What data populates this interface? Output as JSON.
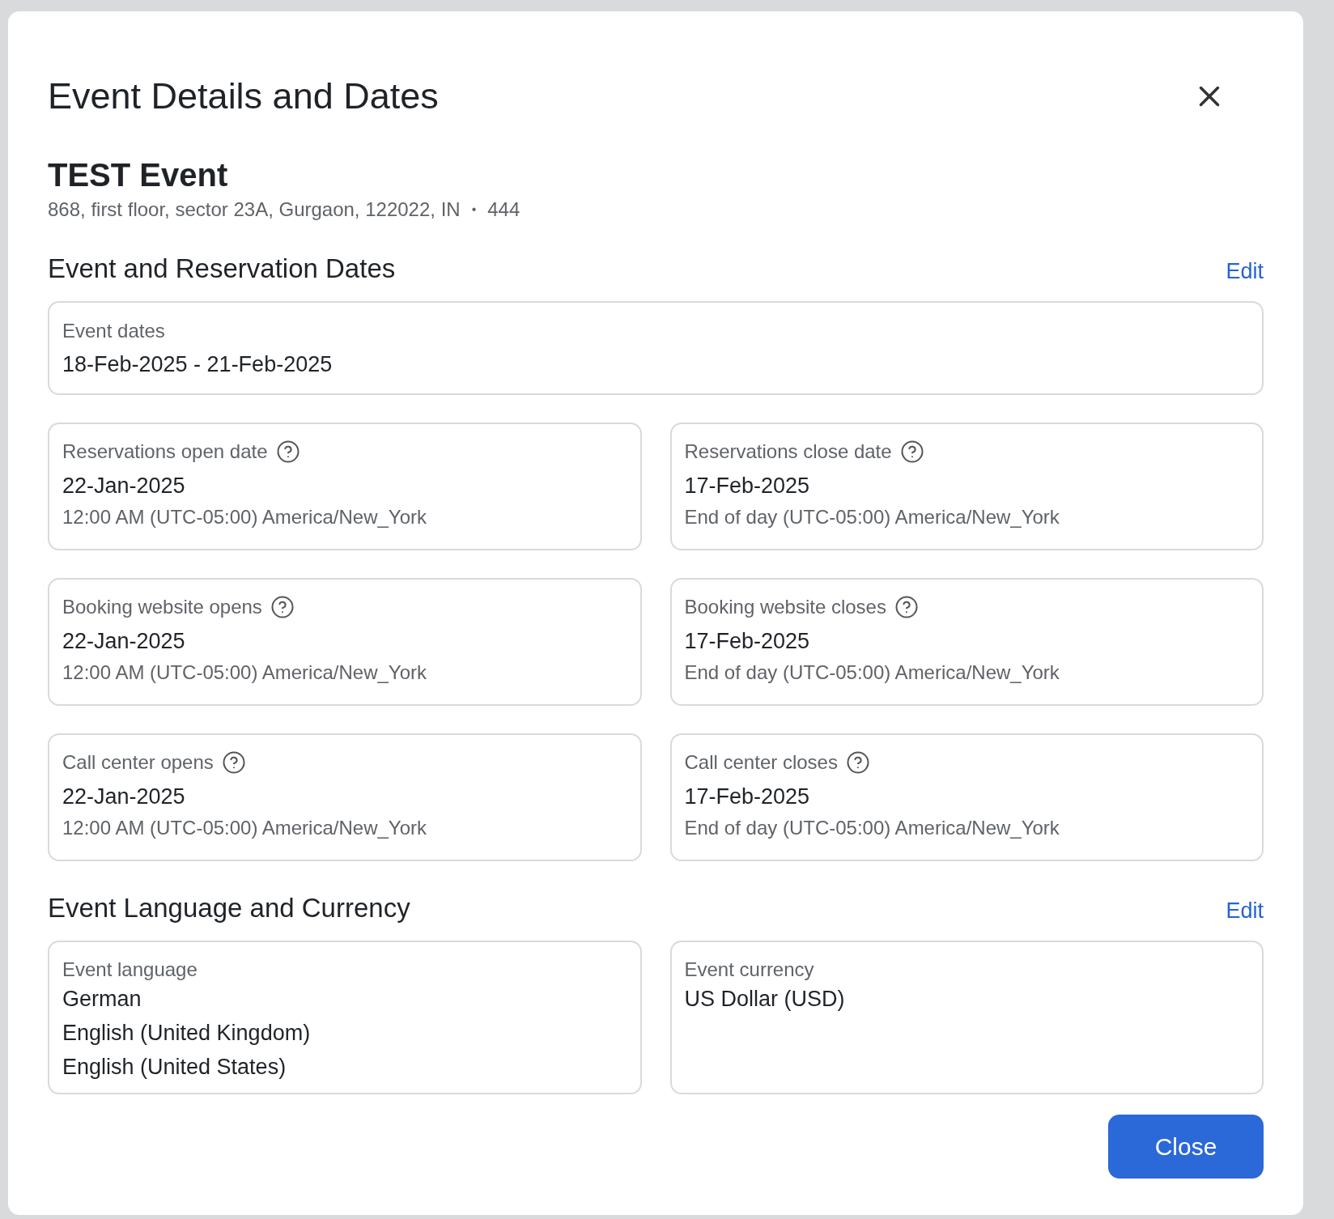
{
  "dialog": {
    "title": "Event Details and Dates"
  },
  "event": {
    "name": "TEST Event",
    "address": "868, first floor, sector 23A, Gurgaon, 122022, IN",
    "separator": "•",
    "code": "444"
  },
  "dates_section": {
    "heading": "Event and Reservation Dates",
    "edit": "Edit",
    "event_dates": {
      "label": "Event dates",
      "value": "18-Feb-2025 - 21-Feb-2025"
    },
    "items": [
      {
        "label": "Reservations open date",
        "date": "22-Jan-2025",
        "detail": "12:00 AM (UTC-05:00) America/New_York"
      },
      {
        "label": "Reservations close date",
        "date": "17-Feb-2025",
        "detail": "End of day (UTC-05:00) America/New_York"
      },
      {
        "label": "Booking website opens",
        "date": "22-Jan-2025",
        "detail": "12:00 AM (UTC-05:00) America/New_York"
      },
      {
        "label": "Booking website closes",
        "date": "17-Feb-2025",
        "detail": "End of day (UTC-05:00) America/New_York"
      },
      {
        "label": "Call center opens",
        "date": "22-Jan-2025",
        "detail": "12:00 AM (UTC-05:00) America/New_York"
      },
      {
        "label": "Call center closes",
        "date": "17-Feb-2025",
        "detail": "End of day (UTC-05:00) America/New_York"
      }
    ]
  },
  "language_section": {
    "heading": "Event Language and Currency",
    "edit": "Edit",
    "cards": [
      {
        "label": "Event language",
        "values": [
          "German",
          "English (United Kingdom)",
          "English (United States)"
        ]
      },
      {
        "label": "Event currency",
        "values": [
          "US Dollar (USD)"
        ]
      }
    ]
  },
  "buttons": {
    "close": "Close"
  }
}
